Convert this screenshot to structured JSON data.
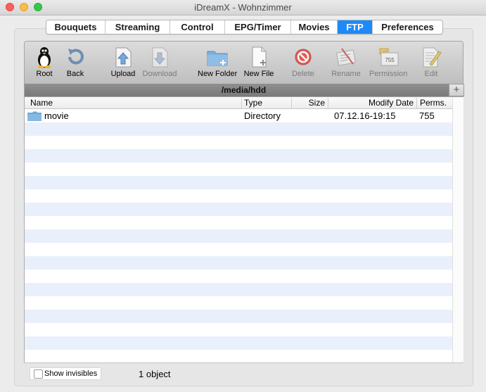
{
  "window": {
    "title": "iDreamX - Wohnzimmer"
  },
  "tabs": [
    {
      "label": "Bouquets"
    },
    {
      "label": "Streaming"
    },
    {
      "label": "Control"
    },
    {
      "label": "EPG/Timer"
    },
    {
      "label": "Movies"
    },
    {
      "label": "FTP"
    },
    {
      "label": "Preferences"
    }
  ],
  "active_tab": "FTP",
  "toolbar": {
    "root": "Root",
    "back": "Back",
    "upload": "Upload",
    "download": "Download",
    "new_folder": "New Folder",
    "new_file": "New File",
    "delete": "Delete",
    "rename": "Rename",
    "permission": "Permission",
    "permission_badge": "755",
    "edit": "Edit"
  },
  "path": "/media/hdd",
  "add_button": "+",
  "table": {
    "headers": {
      "name": "Name",
      "type": "Type",
      "size": "Size",
      "modify_date": "Modify Date",
      "perms": "Perms."
    },
    "rows": [
      {
        "name": "movie",
        "type": "Directory",
        "size": "",
        "modify_date": "07.12.16-19:15",
        "perms": "755"
      }
    ]
  },
  "footer": {
    "show_invisibles": "Show invisibles",
    "count": "1 object"
  },
  "colors": {
    "accent": "#1e8af8",
    "row_stripe": "#e9f0fb",
    "folder": "#7aaedb"
  }
}
